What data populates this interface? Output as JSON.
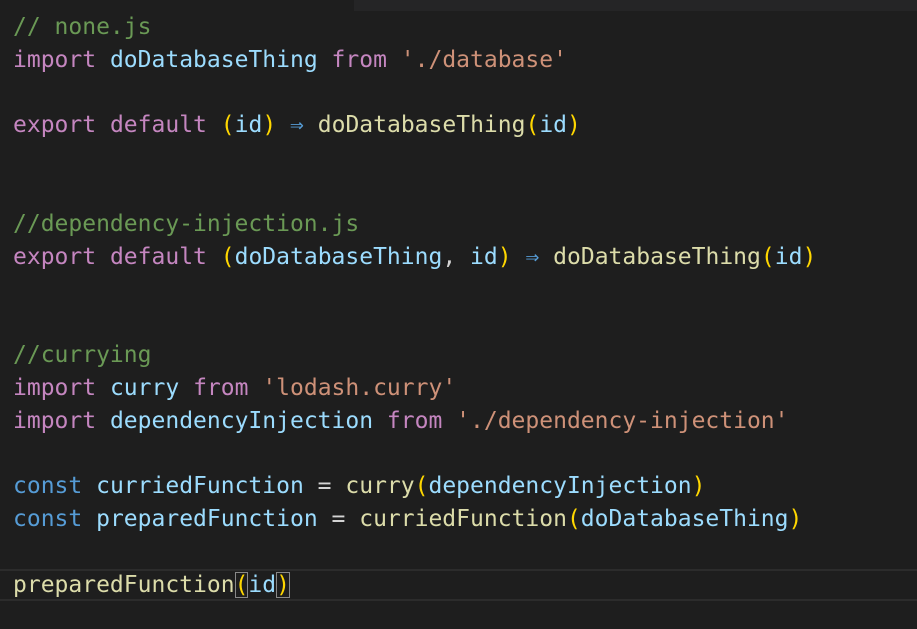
{
  "editor": {
    "lines": [
      [
        {
          "t": "// none.js",
          "c": "comment"
        }
      ],
      [
        {
          "t": "import",
          "c": "kw-ctrl"
        },
        {
          "t": " "
        },
        {
          "t": "doDatabaseThing",
          "c": "var"
        },
        {
          "t": " "
        },
        {
          "t": "from",
          "c": "kw-ctrl"
        },
        {
          "t": " "
        },
        {
          "t": "'./database'",
          "c": "str"
        }
      ],
      [],
      [
        {
          "t": "export",
          "c": "kw-ctrl"
        },
        {
          "t": " "
        },
        {
          "t": "default",
          "c": "kw-ctrl"
        },
        {
          "t": " "
        },
        {
          "t": "(",
          "c": "brace"
        },
        {
          "t": "id",
          "c": "var"
        },
        {
          "t": ")",
          "c": "brace"
        },
        {
          "t": " "
        },
        {
          "t": "⇒",
          "c": "arrow"
        },
        {
          "t": " "
        },
        {
          "t": "doDatabaseThing",
          "c": "func"
        },
        {
          "t": "(",
          "c": "brace"
        },
        {
          "t": "id",
          "c": "var"
        },
        {
          "t": ")",
          "c": "brace"
        }
      ],
      [],
      [],
      [
        {
          "t": "//dependency-injection.js",
          "c": "comment"
        }
      ],
      [
        {
          "t": "export",
          "c": "kw-ctrl"
        },
        {
          "t": " "
        },
        {
          "t": "default",
          "c": "kw-ctrl"
        },
        {
          "t": " "
        },
        {
          "t": "(",
          "c": "brace"
        },
        {
          "t": "doDatabaseThing",
          "c": "var"
        },
        {
          "t": ", "
        },
        {
          "t": "id",
          "c": "var"
        },
        {
          "t": ")",
          "c": "brace"
        },
        {
          "t": " "
        },
        {
          "t": "⇒",
          "c": "arrow"
        },
        {
          "t": " "
        },
        {
          "t": "doDatabaseThing",
          "c": "func"
        },
        {
          "t": "(",
          "c": "brace"
        },
        {
          "t": "id",
          "c": "var"
        },
        {
          "t": ")",
          "c": "brace"
        }
      ],
      [],
      [],
      [
        {
          "t": "//currying",
          "c": "comment"
        }
      ],
      [
        {
          "t": "import",
          "c": "kw-ctrl"
        },
        {
          "t": " "
        },
        {
          "t": "curry",
          "c": "var"
        },
        {
          "t": " "
        },
        {
          "t": "from",
          "c": "kw-ctrl"
        },
        {
          "t": " "
        },
        {
          "t": "'lodash.curry'",
          "c": "str"
        }
      ],
      [
        {
          "t": "import",
          "c": "kw-ctrl"
        },
        {
          "t": " "
        },
        {
          "t": "dependencyInjection",
          "c": "var"
        },
        {
          "t": " "
        },
        {
          "t": "from",
          "c": "kw-ctrl"
        },
        {
          "t": " "
        },
        {
          "t": "'./dependency-injection'",
          "c": "str"
        }
      ],
      [],
      [
        {
          "t": "const",
          "c": "kw-storage"
        },
        {
          "t": " "
        },
        {
          "t": "curriedFunction",
          "c": "var"
        },
        {
          "t": " = "
        },
        {
          "t": "curry",
          "c": "func"
        },
        {
          "t": "(",
          "c": "brace"
        },
        {
          "t": "dependencyInjection",
          "c": "var"
        },
        {
          "t": ")",
          "c": "brace"
        }
      ],
      [
        {
          "t": "const",
          "c": "kw-storage"
        },
        {
          "t": " "
        },
        {
          "t": "preparedFunction",
          "c": "var"
        },
        {
          "t": " = "
        },
        {
          "t": "curriedFunction",
          "c": "func"
        },
        {
          "t": "(",
          "c": "brace"
        },
        {
          "t": "doDatabaseThing",
          "c": "var"
        },
        {
          "t": ")",
          "c": "brace"
        }
      ],
      [],
      [
        {
          "t": "preparedFunction",
          "c": "func"
        },
        {
          "t": "(",
          "c": "brace bracket-match"
        },
        {
          "t": "id",
          "c": "var"
        },
        {
          "t": ")",
          "c": "brace bracket-match"
        }
      ]
    ],
    "current_line": 17
  },
  "colors": {
    "background": "#1e1e1e",
    "comment": "#6a9955",
    "keyword_control": "#c586c0",
    "keyword_storage": "#569cd6",
    "variable": "#9cdcfe",
    "function": "#dcdcaa",
    "string": "#ce9178",
    "bracket": "#ffd700"
  }
}
